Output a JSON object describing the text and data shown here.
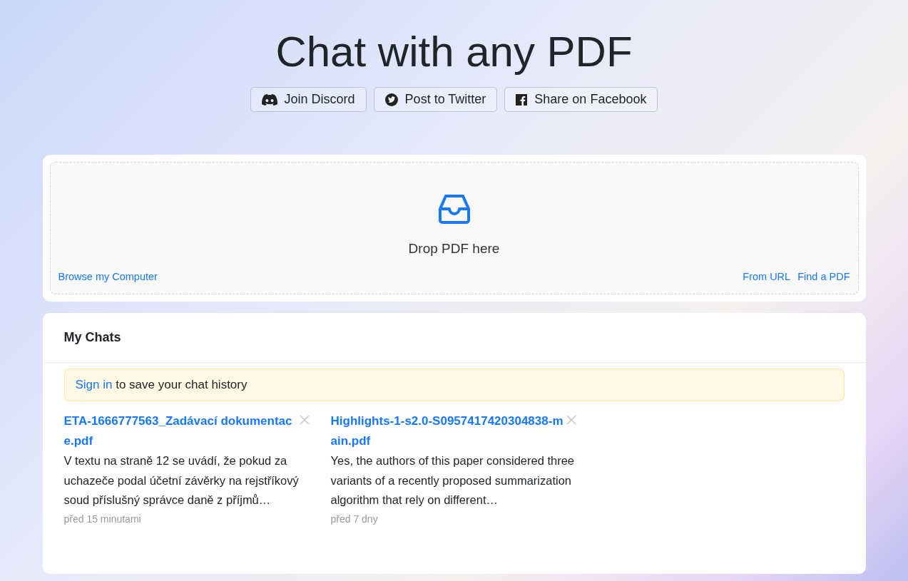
{
  "title": "Chat with any PDF",
  "share_buttons": [
    {
      "kind": "discord",
      "label": "Join Discord"
    },
    {
      "kind": "twitter",
      "label": "Post to Twitter"
    },
    {
      "kind": "facebook",
      "label": "Share on Facebook"
    }
  ],
  "dropzone": {
    "label": "Drop PDF here",
    "left_links": [
      "Browse my Computer"
    ],
    "right_links": [
      "From URL",
      "Find a PDF"
    ]
  },
  "my_chats": {
    "heading": "My Chats",
    "notice": {
      "link": "Sign in",
      "text": "to save your chat history"
    },
    "chats": [
      {
        "title": "ETA-1666777563_Zadávací dokumentace.pdf",
        "preview": "V textu na straně 12 se uvádí, že pokud za uchazeče podal účetní závěrky na rejstříkový soud příslušný správce daně z příjmů…",
        "time": "před 15 minutami"
      },
      {
        "title": "Highlights-1-s2.0-S0957417420304838-main.pdf",
        "preview": "Yes, the authors of this paper considered three variants of a recently proposed summarization algorithm that rely on different…",
        "time": "před 7 dny"
      }
    ]
  }
}
